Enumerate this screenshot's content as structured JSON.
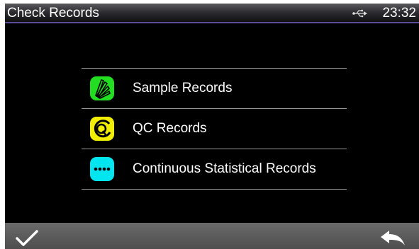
{
  "topbar": {
    "title": "Check Records",
    "time": "23:32",
    "usb_icon": "usb-icon"
  },
  "menu": {
    "items": [
      {
        "label": "Sample Records",
        "icon": "sample-records-icon",
        "color": "#22dd22"
      },
      {
        "label": "QC Records",
        "icon": "qc-records-icon",
        "color": "#f2ee00"
      },
      {
        "label": "Continuous Statistical Records",
        "icon": "continuous-statistical-icon",
        "color": "#00e6f0"
      }
    ]
  },
  "bottombar": {
    "confirm_icon": "checkmark-icon",
    "back_icon": "back-arrow-icon"
  },
  "colors": {
    "screen_bg": "#000000",
    "accent_line": "#5c4a9a",
    "bottom_bar": "#5a5a5a"
  }
}
